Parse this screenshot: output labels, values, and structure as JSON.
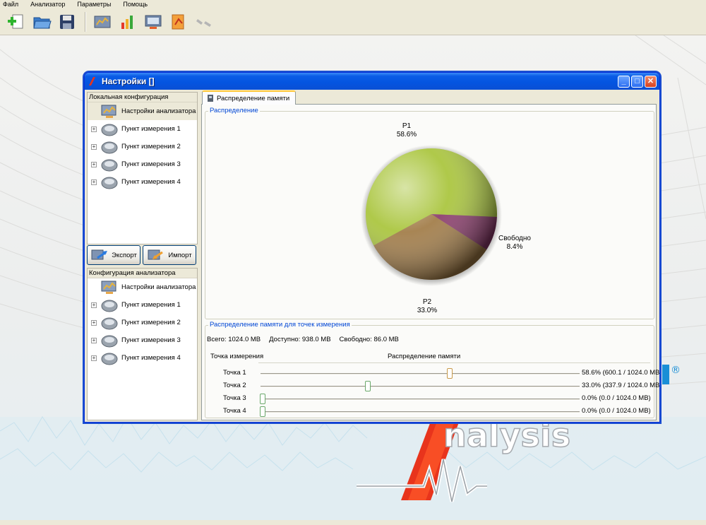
{
  "menu": [
    "Файл",
    "Анализатор",
    "Параметры",
    "Помощь"
  ],
  "toolbar": {
    "icons": [
      "new-icon",
      "open-folder-icon",
      "save-icon",
      "analyzer-settings-icon",
      "chart-icon",
      "monitor-icon",
      "report-icon",
      "disconnect-icon"
    ]
  },
  "dialog": {
    "title": "Настройки []"
  },
  "local_config": {
    "header": "Локальная конфигурация",
    "items": [
      {
        "label": "Настройки анализатора",
        "selected": true
      },
      {
        "label": "Пункт измерения 1"
      },
      {
        "label": "Пункт измерения 2"
      },
      {
        "label": "Пункт измерения 3"
      },
      {
        "label": "Пункт измерения 4"
      }
    ]
  },
  "buttons": {
    "export": "Экспорт",
    "import": "Импорт"
  },
  "analyzer_config": {
    "header": "Конфигурация анализатора",
    "items": [
      {
        "label": "Настройки анализатора"
      },
      {
        "label": "Пункт измерения 1"
      },
      {
        "label": "Пункт измерения 2"
      },
      {
        "label": "Пункт измерения 3"
      },
      {
        "label": "Пункт измерения 4"
      }
    ]
  },
  "tab": {
    "label": "Распределение памяти"
  },
  "distribution": {
    "group_title": "Распределение",
    "labels": {
      "p1_name": "P1",
      "p1_pct": "58.6%",
      "free_name": "Свободно",
      "free_pct": "8.4%",
      "p2_name": "P2",
      "p2_pct": "33.0%"
    }
  },
  "chart_data": {
    "type": "pie",
    "categories": [
      "P1",
      "P2",
      "Свободно"
    ],
    "values": [
      58.6,
      33.0,
      8.4
    ],
    "colors": [
      "#a8c43a",
      "#a07a45",
      "#8a3a6a"
    ]
  },
  "points": {
    "group_title": "Распределение памяти для точек измерения",
    "total": "Всего: 1024.0 MB",
    "available": "Доступно: 938.0 MB",
    "free": "Свободно: 86.0 MB",
    "col_point": "Точка измерения",
    "col_dist": "Распределение памяти",
    "rows": [
      {
        "label": "Точка 1",
        "value": "58.6% (600.1 / 1024.0 MB)",
        "fraction": 0.586
      },
      {
        "label": "Точка 2",
        "value": "33.0% (337.9 / 1024.0 MB)",
        "fraction": 0.33
      },
      {
        "label": "Точка 3",
        "value": "0.0% (0.0 / 1024.0 MB)",
        "fraction": 0.0
      },
      {
        "label": "Точка 4",
        "value": "0.0% (0.0 / 1024.0 MB)",
        "fraction": 0.0
      }
    ]
  },
  "brand": {
    "text": "nalysis",
    "mark": "®"
  }
}
